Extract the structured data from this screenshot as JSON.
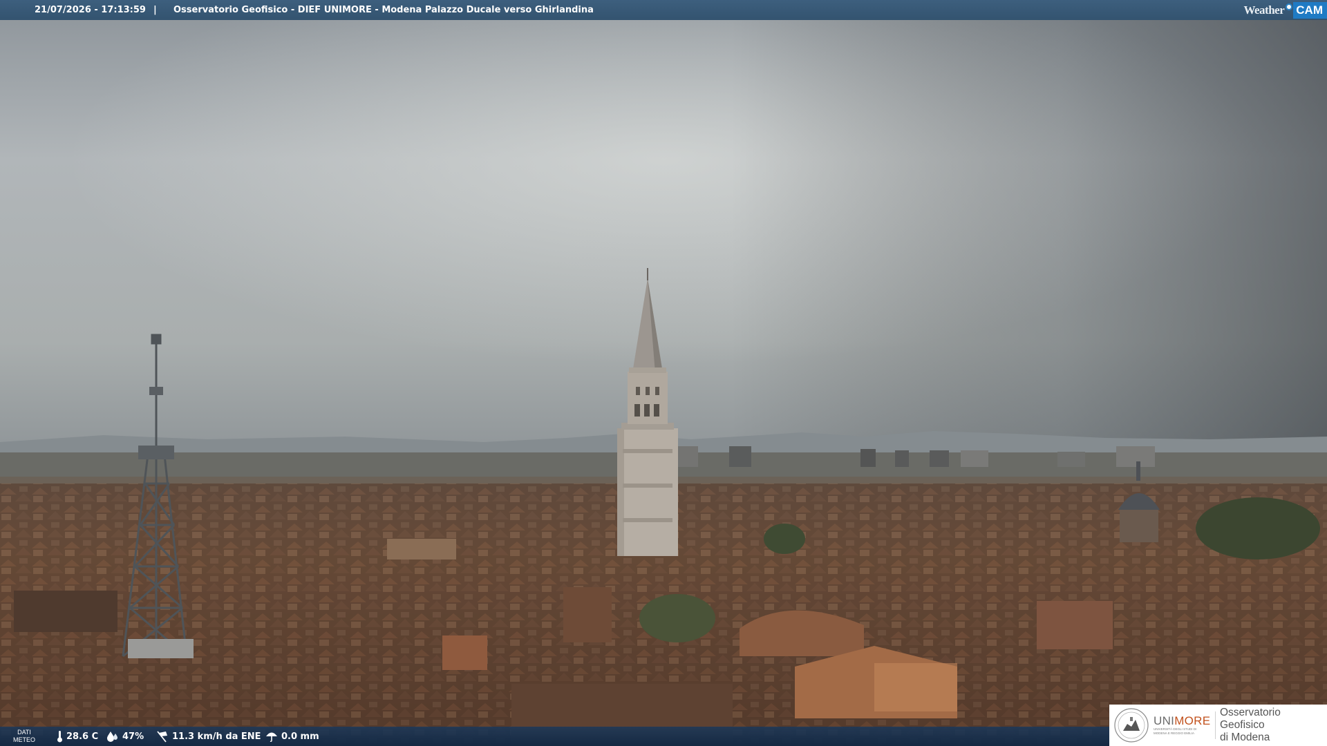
{
  "header": {
    "timestamp": "21/07/2026 - 17:13:59",
    "separator": "|",
    "title": "Osservatorio Geofisico - DIEF UNIMORE - Modena Palazzo Ducale verso Ghirlandina"
  },
  "weathercam_logo": {
    "weather": "Weather",
    "cam": "CAM"
  },
  "meteo": {
    "label_line1": "DATI",
    "label_line2": "METEO",
    "temperature": "28.6 C",
    "humidity": "47%",
    "wind": "11.3 km/h da ENE",
    "rain": "0.0 mm"
  },
  "unimore": {
    "uni": "UNI",
    "more": "MORE",
    "subtitle_line1": "UNIVERSITÀ DEGLI STUDI DI",
    "subtitle_line2": "MODENA E REGGIO EMILIA",
    "observatory_line1": "Osservatorio Geofisico",
    "observatory_line2": "di Modena"
  },
  "icons": {
    "temperature": "thermometer-icon",
    "humidity": "droplet-icon",
    "wind": "wind-sock-icon",
    "rain": "umbrella-icon"
  },
  "colors": {
    "topbar": "#33536f",
    "meteobar": "#1b385a",
    "unimore_accent": "#c2511c",
    "cam_badge": "#1f7bc4"
  }
}
